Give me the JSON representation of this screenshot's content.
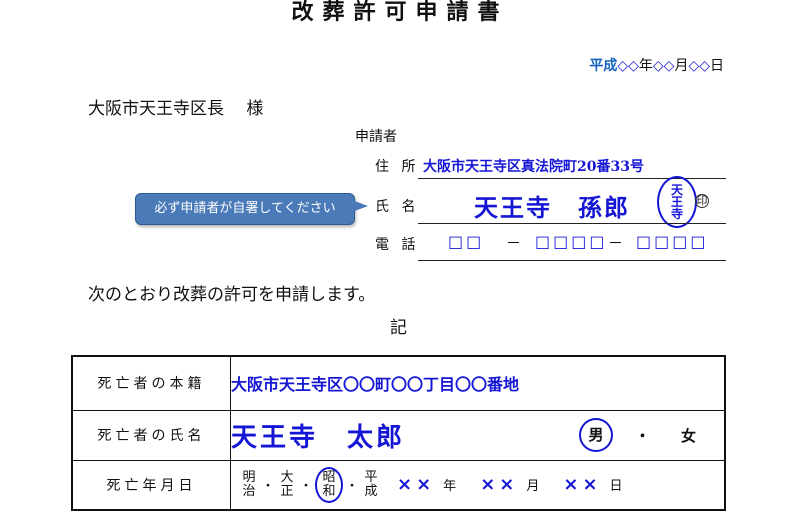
{
  "title": "改葬許可申請書",
  "date": {
    "era": "平成",
    "year": "◇◇",
    "year_unit": "年",
    "month": "◇◇",
    "month_unit": "月",
    "day": "◇◇",
    "day_unit": "日"
  },
  "addressee": "大阪市天王寺区長　 様",
  "applicant": {
    "section_label": "申請者",
    "address_label": "住 所",
    "address_value": "大阪市天王寺区真法院町20番33号",
    "name_label": "氏 名",
    "name_value": "天王寺　孫郎",
    "seal_chars": [
      "天",
      "王",
      "寺"
    ],
    "seal_mark": "印",
    "phone_label": "電 話",
    "phone_part1": "□□",
    "phone_sep1": "－",
    "phone_part2": "□□□□",
    "phone_sep2": "－",
    "phone_part3": "□□□□"
  },
  "callout": "必ず申請者が自署してください",
  "sentence": "次のとおり改葬の許可を申請します。",
  "ki": "記",
  "table": {
    "rows": [
      {
        "label": "死亡者の本籍",
        "value": "大阪市天王寺区〇〇町〇〇丁目〇〇番地"
      },
      {
        "label": "死亡者の氏名",
        "value": "天王寺　太郎"
      },
      {
        "label": "死亡年月日"
      }
    ],
    "sex": {
      "male": "男",
      "dot": "・",
      "female": "女",
      "selected": "male"
    },
    "eras": [
      {
        "line1": "明",
        "line2": "治",
        "selected": false
      },
      {
        "line1": "大",
        "line2": "正",
        "selected": false
      },
      {
        "line1": "昭",
        "line2": "和",
        "selected": true
      },
      {
        "line1": "平",
        "line2": "成",
        "selected": false
      }
    ],
    "era_sep": "・",
    "death": {
      "year": "××",
      "year_unit": "年",
      "month": "××",
      "month_unit": "月",
      "day": "××",
      "day_unit": "日"
    }
  },
  "colors": {
    "ink_blue": "#1515d6",
    "callout_bg": "#4a7ab8",
    "era_blue": "#1565c0"
  }
}
